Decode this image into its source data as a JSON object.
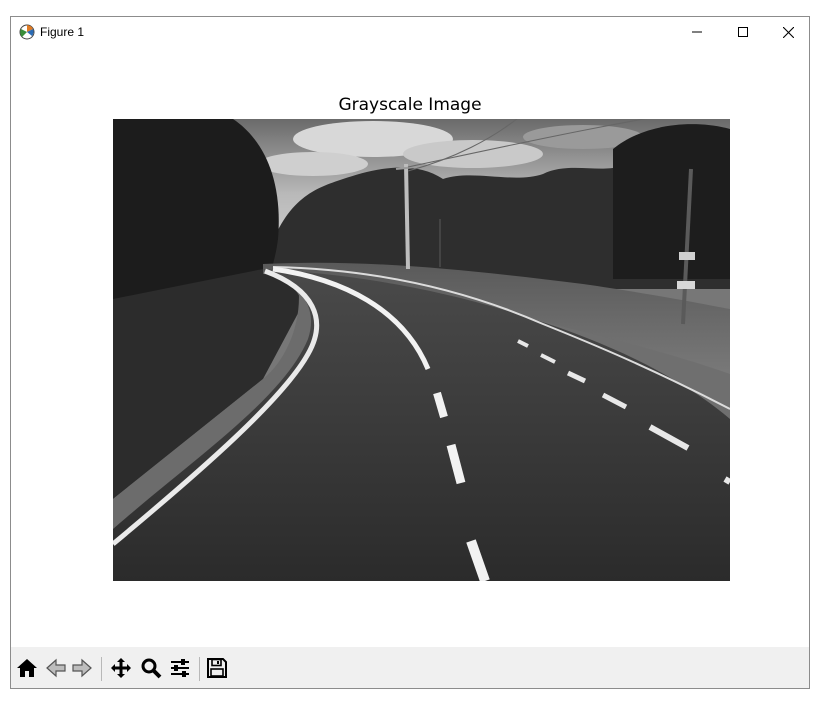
{
  "window": {
    "title": "Figure 1"
  },
  "figure": {
    "title": "Grayscale Image"
  },
  "toolbar": {
    "buttons": [
      "home-icon",
      "back-icon",
      "forward-icon",
      "pan-icon",
      "zoom-icon",
      "configure-subplots-icon",
      "save-icon"
    ]
  },
  "colors": {
    "toolbar_bg": "#f0f0f0",
    "window_border": "#8c8c8c"
  }
}
